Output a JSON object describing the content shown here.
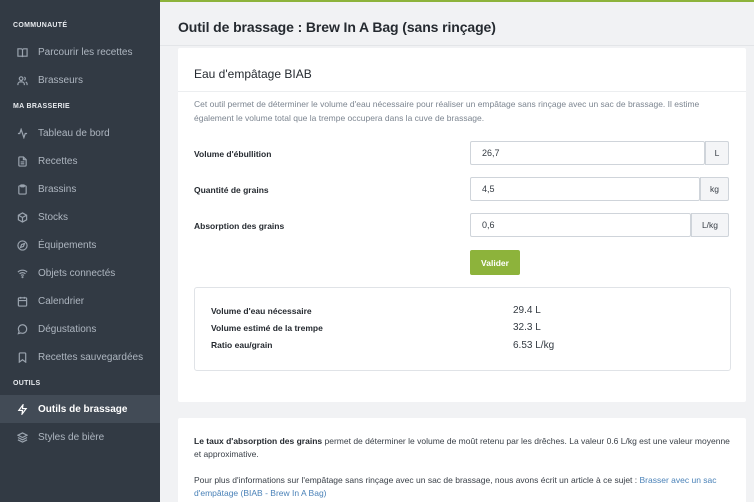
{
  "sidebar": {
    "sections": {
      "community": "COMMUNAUTÉ",
      "brewery": "MA BRASSERIE",
      "tools": "OUTILS"
    },
    "items": [
      {
        "label": "Parcourir les recettes",
        "icon": "book-icon"
      },
      {
        "label": "Brasseurs",
        "icon": "users-icon"
      },
      {
        "label": "Tableau de bord",
        "icon": "activity-icon"
      },
      {
        "label": "Recettes",
        "icon": "file-icon"
      },
      {
        "label": "Brassins",
        "icon": "clipboard-icon"
      },
      {
        "label": "Stocks",
        "icon": "box-icon"
      },
      {
        "label": "Équipements",
        "icon": "compass-icon"
      },
      {
        "label": "Objets connectés",
        "icon": "wifi-icon"
      },
      {
        "label": "Calendrier",
        "icon": "calendar-icon"
      },
      {
        "label": "Dégustations",
        "icon": "message-icon"
      },
      {
        "label": "Recettes sauvegardées",
        "icon": "bookmark-icon"
      },
      {
        "label": "Outils de brassage",
        "icon": "zap-icon",
        "active": true
      },
      {
        "label": "Styles de bière",
        "icon": "layers-icon"
      }
    ]
  },
  "header": {
    "title": "Outil de brassage : Brew In A Bag (sans rinçage)"
  },
  "calculator": {
    "title": "Eau d'empâtage BIAB",
    "description": "Cet outil permet de déterminer le volume d'eau nécessaire pour réaliser un empâtage sans rinçage avec un sac de brassage. Il estime également le volume total que la trempe occupera dans la cuve de brassage.",
    "fields": {
      "boil_volume": {
        "label": "Volume d'ébullition",
        "value": "26,7",
        "unit": "L"
      },
      "grain_quantity": {
        "label": "Quantité de grains",
        "value": "4,5",
        "unit": "kg"
      },
      "grain_absorption": {
        "label": "Absorption des grains",
        "value": "0,6",
        "unit": "L/kg"
      }
    },
    "submit_label": "Valider",
    "results": {
      "water_needed": {
        "label": "Volume d'eau nécessaire",
        "value": "29.4 L"
      },
      "mash_volume": {
        "label": "Volume estimé de la trempe",
        "value": "32.3 L"
      },
      "ratio": {
        "label": "Ratio eau/grain",
        "value": "6.53 L/kg"
      }
    }
  },
  "info": {
    "absorption_bold": "Le taux d'absorption des grains",
    "absorption_text": " permet de déterminer le volume de moût retenu par les drêches. La valeur 0.6 L/kg est une valeur moyenne et approximative.",
    "more_text": "Pour plus d'informations sur l'empâtage sans rinçage avec un sac de brassage, nous avons écrit un article à ce sujet : ",
    "more_link": "Brasser avec un sac d'empâtage (BIAB - Brew In A Bag)"
  },
  "colors": {
    "sidebar_bg": "#323a44",
    "accent": "#8db33b",
    "link": "#4a82b8"
  }
}
